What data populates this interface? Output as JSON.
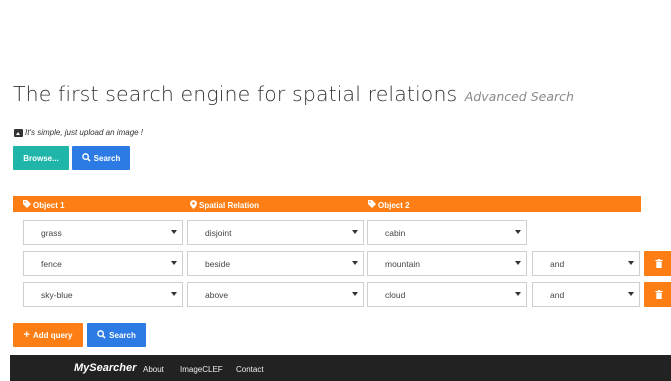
{
  "title": {
    "main": "The first search engine for spatial relations",
    "subtitle": "Advanced Search"
  },
  "upload": {
    "hint": "It's simple, just upload an image !",
    "hint_icon": "image-icon",
    "browse_label": "Browse...",
    "search_label": "Search",
    "search_icon": "search-icon"
  },
  "table_header": {
    "object1": "Object 1",
    "relation": "Spatial Relation",
    "object2": "Object 2",
    "object_icon": "tag-icon",
    "relation_icon": "map-marker-icon"
  },
  "rows": [
    {
      "object1": "grass",
      "relation": "disjoint",
      "object2": "cabin",
      "connector": "",
      "deletable": false
    },
    {
      "object1": "fence",
      "relation": "beside",
      "object2": "mountain",
      "connector": "and",
      "deletable": true
    },
    {
      "object1": "sky-blue",
      "relation": "above",
      "object2": "cloud",
      "connector": "and",
      "deletable": true
    }
  ],
  "actions": {
    "add_query_label": "Add query",
    "add_icon": "plus-icon",
    "search_label": "Search"
  },
  "navbar": {
    "brand": "MySearcher",
    "links": [
      "About",
      "ImageCLEF",
      "Contact"
    ]
  },
  "colors": {
    "orange": "#fd7e14",
    "teal": "#1fb5a8",
    "blue": "#2c7be5",
    "navbar": "#222222"
  }
}
